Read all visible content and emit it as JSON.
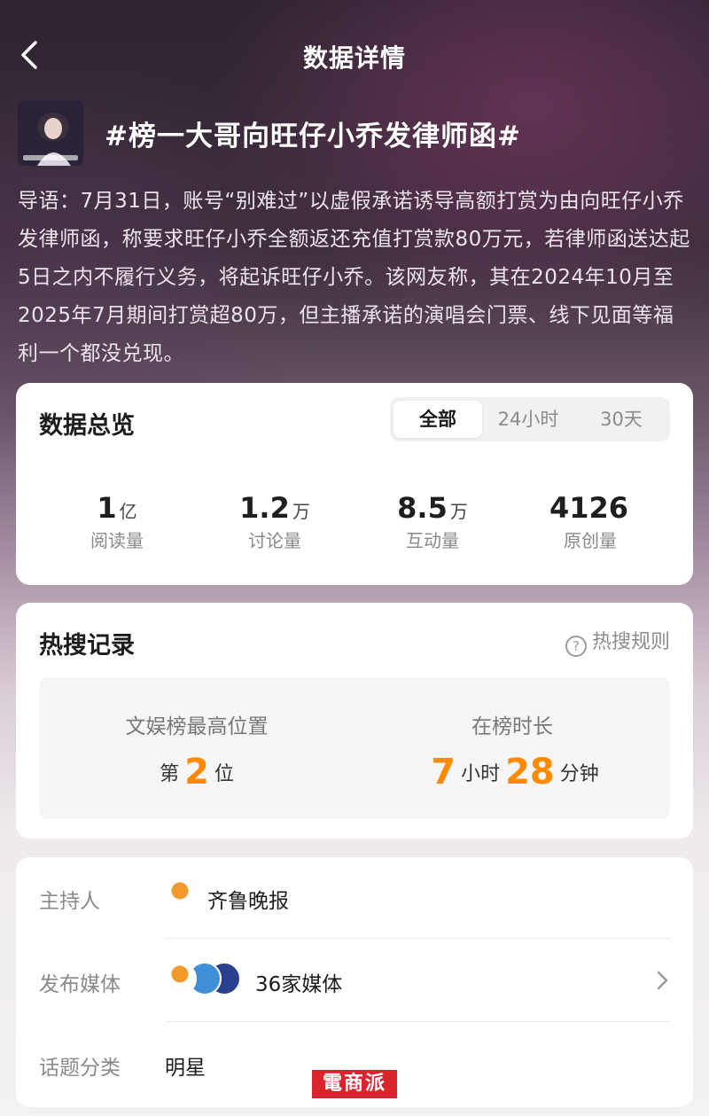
{
  "header": {
    "title": "数据详情"
  },
  "topic": {
    "title": "#榜一大哥向旺仔小乔发律师函#",
    "intro": "导语：7月31日，账号“别难过”以虚假承诺诱导高额打赏为由向旺仔小乔发律师函，称要求旺仔小乔全额返还充值打赏款80万元，若律师函送达起5日之内不履行义务，将起诉旺仔小乔。该网友称，其在2024年10月至2025年7月期间打赏超80万，但主播承诺的演唱会门票、线下见面等福利一个都没兑现。"
  },
  "overview": {
    "title": "数据总览",
    "tabs": [
      {
        "label": "全部",
        "active": true
      },
      {
        "label": "24小时",
        "active": false
      },
      {
        "label": "30天",
        "active": false
      }
    ],
    "stats": [
      {
        "value": "1",
        "unit": "亿",
        "label": "阅读量"
      },
      {
        "value": "1.2",
        "unit": "万",
        "label": "讨论量"
      },
      {
        "value": "8.5",
        "unit": "万",
        "label": "互动量"
      },
      {
        "value": "4126",
        "unit": "",
        "label": "原创量"
      }
    ]
  },
  "hot": {
    "title": "热搜记录",
    "rules_label": "热搜规则",
    "peak": {
      "label": "文娱榜最高位置",
      "prefix": "第",
      "value": "2",
      "suffix": "位"
    },
    "duration": {
      "label": "在榜时长",
      "hours": "7",
      "hours_unit": "小时",
      "minutes": "28",
      "minutes_unit": "分钟"
    }
  },
  "info": {
    "host_label": "主持人",
    "host_name": "齐鲁晚报",
    "media_label": "发布媒体",
    "media_count": "36家媒体",
    "category_label": "话题分类",
    "category_value": "明星"
  },
  "watermark": "電商派",
  "colors": {
    "accent": "#ff8a00",
    "watermark_bg": "#d9232d"
  }
}
